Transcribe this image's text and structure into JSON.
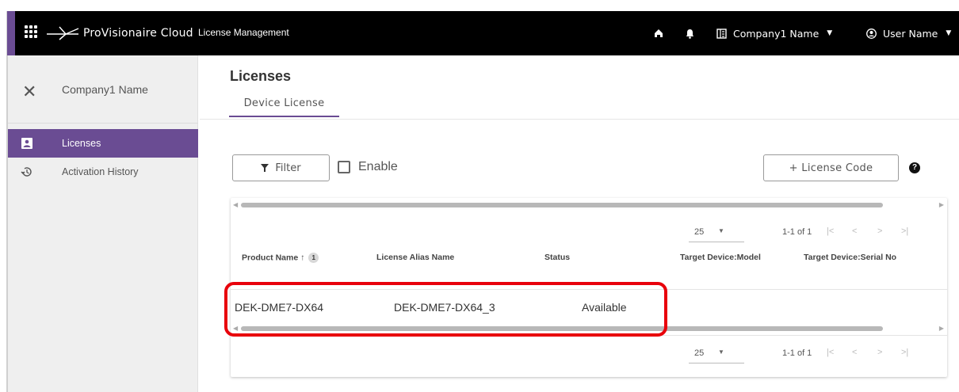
{
  "header": {
    "logo_text": "ProVisionaire Cloud",
    "app_title": "License Management",
    "company_menu": "Company1 Name",
    "user_menu": "User Name"
  },
  "sidebar": {
    "company": "Company1 Name",
    "items": [
      {
        "label": "Licenses",
        "icon": "license-icon",
        "active": true
      },
      {
        "label": "Activation History",
        "icon": "history-icon",
        "active": false
      }
    ]
  },
  "main": {
    "title": "Licenses",
    "tabs": [
      {
        "label": "Device License",
        "active": true
      }
    ],
    "filter_label": "Filter",
    "enable_label": "Enable",
    "enable_checked": false,
    "license_code_label": "+ License Code"
  },
  "table": {
    "columns": [
      {
        "label": "Product Name",
        "sort": "asc",
        "sort_order": "1"
      },
      {
        "label": "License Alias Name"
      },
      {
        "label": "Status"
      },
      {
        "label": "Target Device:Model"
      },
      {
        "label": "Target Device:Serial No"
      }
    ],
    "rows": [
      {
        "product_name": "DEK-DME7-DX64",
        "alias": "DEK-DME7-DX64_3",
        "status": "Available",
        "model": "",
        "serial": ""
      }
    ],
    "pagination": {
      "per_page": "25",
      "range": "1-1 of 1"
    }
  },
  "colors": {
    "accent": "#6a4c93",
    "highlight": "#e8000b",
    "topbar": "#000000"
  }
}
